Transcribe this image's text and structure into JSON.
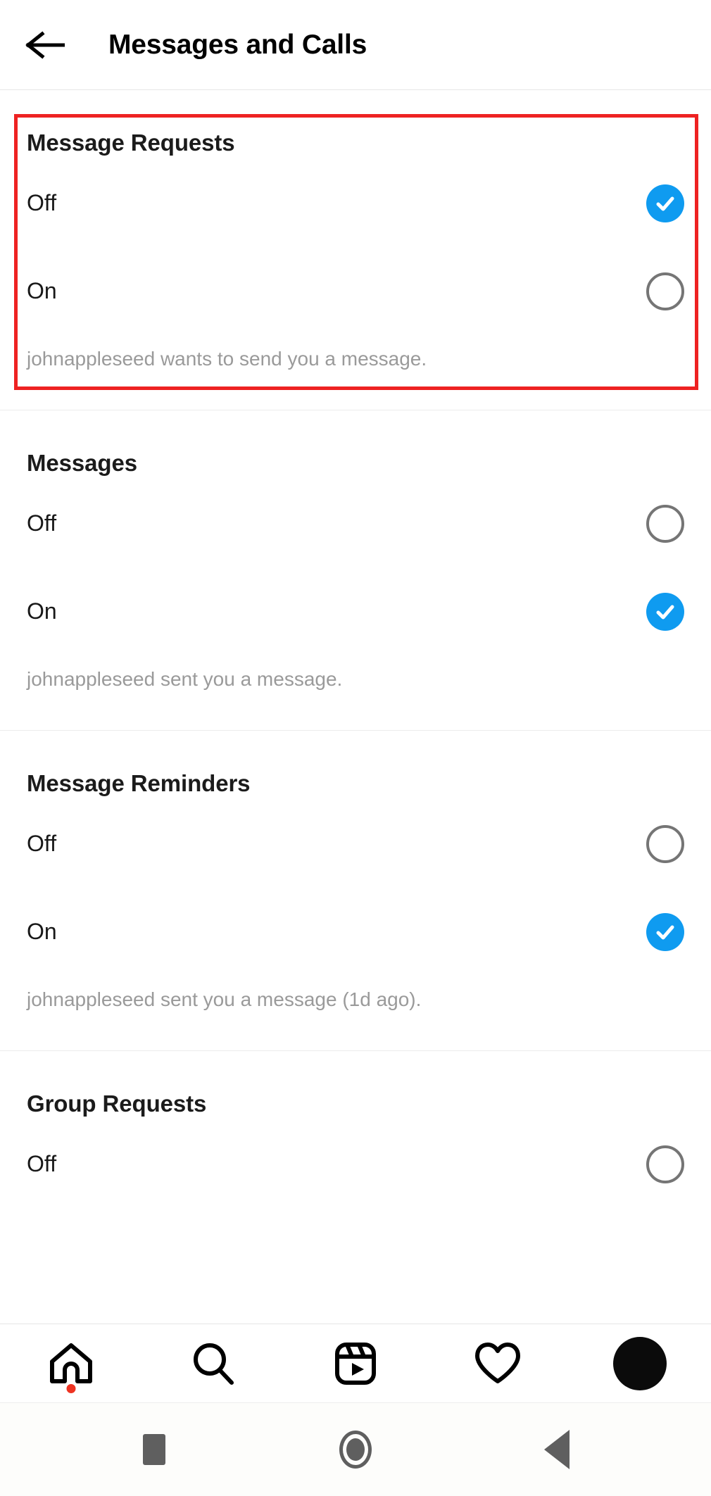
{
  "appbar": {
    "back_icon": "arrow-left-icon",
    "title": "Messages and Calls"
  },
  "sections": [
    {
      "title": "Message Requests",
      "options": [
        {
          "label": "Off",
          "selected": true
        },
        {
          "label": "On",
          "selected": false
        }
      ],
      "description": "johnappleseed wants to send you a message.",
      "highlighted": true
    },
    {
      "title": "Messages",
      "options": [
        {
          "label": "Off",
          "selected": false
        },
        {
          "label": "On",
          "selected": true
        }
      ],
      "description": "johnappleseed sent you a message.",
      "highlighted": false
    },
    {
      "title": "Message Reminders",
      "options": [
        {
          "label": "Off",
          "selected": false
        },
        {
          "label": "On",
          "selected": true
        }
      ],
      "description": "johnappleseed sent you a message (1d ago).",
      "highlighted": false
    },
    {
      "title": "Group Requests",
      "options": [
        {
          "label": "Off",
          "selected": false
        }
      ],
      "description": "",
      "highlighted": false
    }
  ],
  "tabbar": {
    "items": [
      {
        "icon": "home-icon",
        "badge": true
      },
      {
        "icon": "search-icon",
        "badge": false
      },
      {
        "icon": "reels-icon",
        "badge": false
      },
      {
        "icon": "heart-icon",
        "badge": false
      },
      {
        "icon": "profile-avatar",
        "badge": false
      }
    ]
  },
  "sysnav": {
    "items": [
      {
        "icon": "recents-square-icon"
      },
      {
        "icon": "home-circle-icon"
      },
      {
        "icon": "back-triangle-icon"
      }
    ]
  },
  "colors": {
    "accent_blue": "#0f9bf0",
    "radio_off_gray": "#757575",
    "annotation_red": "#ee2222",
    "description_gray": "#9a9a9a",
    "notification_dot_red": "#ee3322"
  }
}
